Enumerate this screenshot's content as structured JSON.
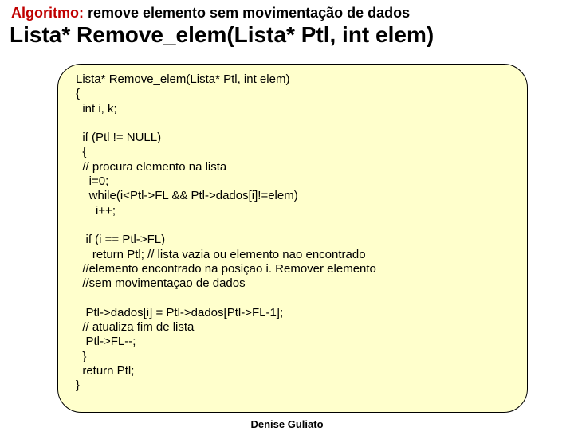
{
  "heading": {
    "prefix": "Algoritmo:",
    "rest": " remove elemento sem movimentação de dados",
    "signature": "Lista* Remove_elem(Lista* Ptl, int elem)"
  },
  "code": "Lista* Remove_elem(Lista* Ptl, int elem)\n{\n  int i, k;\n\n  if (Ptl != NULL)\n  {\n  // procura elemento na lista\n    i=0;\n    while(i<Ptl->FL && Ptl->dados[i]!=elem)\n      i++;\n\n   if (i == Ptl->FL)\n     return Ptl; // lista vazia ou elemento nao encontrado\n  //elemento encontrado na posiçao i. Remover elemento\n  //sem movimentaçao de dados\n\n   Ptl->dados[i] = Ptl->dados[Ptl->FL-1];\n  // atualiza fim de lista\n   Ptl->FL--;\n  }\n  return Ptl;\n}",
  "footer": "Denise Guliato"
}
